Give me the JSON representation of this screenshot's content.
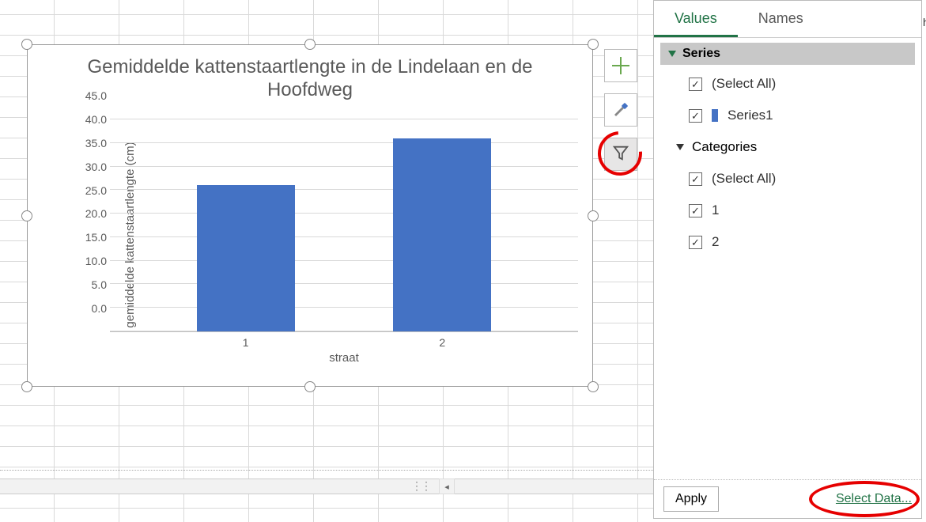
{
  "chart_data": {
    "type": "bar",
    "title": "Gemiddelde kattenstaartlengte in de Lindelaan en de Hoofdweg",
    "xlabel": "straat",
    "ylabel": "gemiddelde kattenstaartlengte (cm)",
    "categories": [
      "1",
      "2"
    ],
    "values": [
      31.0,
      41.0
    ],
    "yticks": [
      "0.0",
      "5.0",
      "10.0",
      "15.0",
      "20.0",
      "25.0",
      "30.0",
      "35.0",
      "40.0",
      "45.0"
    ],
    "ylim": [
      0,
      45
    ],
    "series_name": "Series1"
  },
  "chart_buttons": {
    "add": "plus-icon",
    "style": "brush-icon",
    "filter": "funnel-icon"
  },
  "filter_panel": {
    "tabs": {
      "values": "Values",
      "names": "Names",
      "active": "Values"
    },
    "series": {
      "header": "Series",
      "select_all": "(Select All)",
      "items": [
        {
          "label": "Series1",
          "checked": true,
          "color": "#4472c4"
        }
      ]
    },
    "categories": {
      "header": "Categories",
      "select_all": "(Select All)",
      "items": [
        {
          "label": "1",
          "checked": true
        },
        {
          "label": "2",
          "checked": true
        }
      ]
    },
    "footer": {
      "apply": "Apply",
      "select_data": "Select Data..."
    }
  },
  "right_hint": "h"
}
